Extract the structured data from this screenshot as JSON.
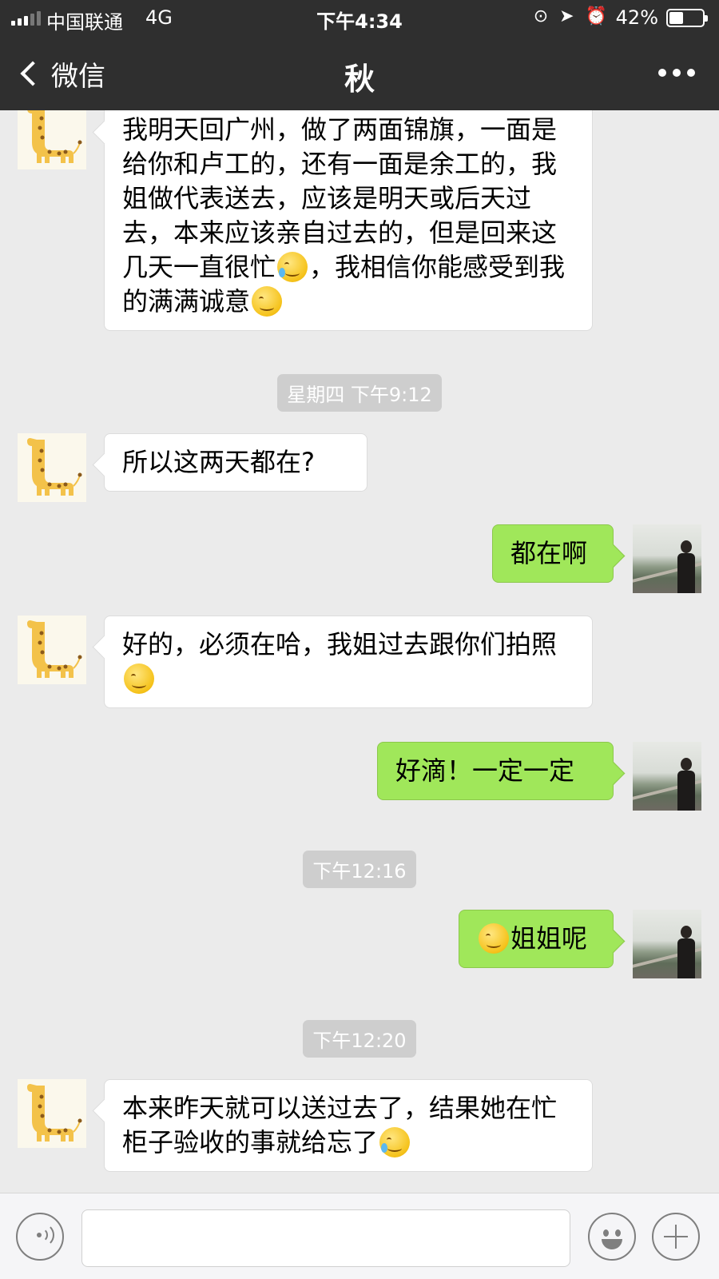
{
  "status_bar": {
    "carrier": "中国联通",
    "network": "4G",
    "time": "下午4:34",
    "battery_percent": "42%",
    "battery_level": 0.42,
    "icons": [
      "orientation-lock-icon",
      "location-icon",
      "alarm-icon"
    ]
  },
  "nav": {
    "back_label": "微信",
    "title": "秋",
    "more_icon": "more-icon"
  },
  "messages": [
    {
      "type": "received",
      "avatar": "giraffe-avatar",
      "parts": [
        {
          "text": "我明天回广州，做了两面锦旗，一面是给你和卢工的，还有一面是余工的，我姐做代表送去，应该是明天或后天过去，本来应该亲自过去的，但是回来这几天一直很忙"
        },
        {
          "emoji": "crying-laughing-emoji"
        },
        {
          "text": "，我相信你能感受到我的满满诚意"
        },
        {
          "emoji": "smirk-emoji"
        }
      ]
    },
    {
      "type": "timestamp",
      "text": "星期四 下午9:12"
    },
    {
      "type": "received",
      "avatar": "giraffe-avatar",
      "parts": [
        {
          "text": "所以这两天都在?"
        }
      ]
    },
    {
      "type": "sent",
      "avatar": "photo-avatar",
      "parts": [
        {
          "text": "都在啊"
        }
      ]
    },
    {
      "type": "received",
      "avatar": "giraffe-avatar",
      "parts": [
        {
          "text": "好的，必须在哈，我姐过去跟你们拍照"
        },
        {
          "emoji": "skeptical-emoji"
        }
      ]
    },
    {
      "type": "sent",
      "avatar": "photo-avatar",
      "parts": [
        {
          "text": "好滴！一定一定"
        }
      ]
    },
    {
      "type": "timestamp",
      "text": "下午12:16"
    },
    {
      "type": "sent",
      "avatar": "photo-avatar",
      "parts": [
        {
          "emoji": "smug-emoji"
        },
        {
          "text": "姐姐呢"
        }
      ]
    },
    {
      "type": "timestamp",
      "text": "下午12:20"
    },
    {
      "type": "received",
      "avatar": "giraffe-avatar",
      "parts": [
        {
          "text": "本来昨天就可以送过去了，结果她在忙柜子验收的事就给忘了"
        },
        {
          "emoji": "crying-laughing-emoji"
        }
      ]
    }
  ],
  "input_bar": {
    "voice_icon": "voice-icon",
    "emoji_icon": "emoji-icon",
    "add_icon": "plus-icon",
    "input_value": ""
  },
  "colors": {
    "navbar": "#2f2f2f",
    "chat_background": "#ebebeb",
    "sent_bubble": "#a0e75a",
    "received_bubble": "#ffffff",
    "timestamp_background": "#cecece"
  }
}
